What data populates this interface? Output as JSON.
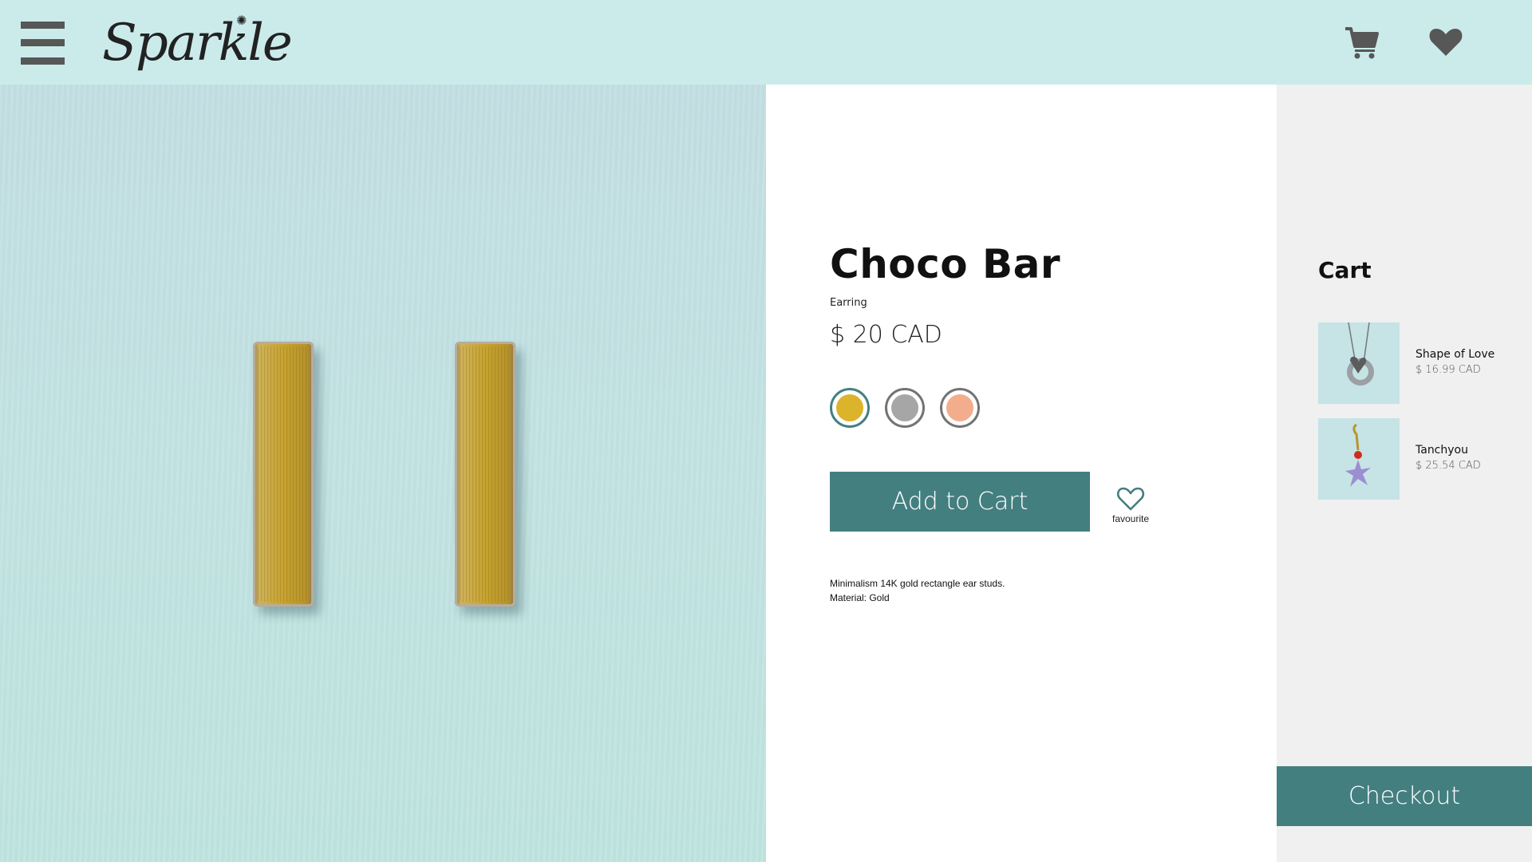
{
  "header": {
    "logo_text": "Sparkle",
    "logo_sparkle_glyph": "✺",
    "icons": [
      "menu-icon",
      "cart-icon",
      "heart-icon"
    ]
  },
  "product": {
    "title": "Choco Bar",
    "category": "Earring",
    "price": "$ 20 CAD",
    "swatches": [
      {
        "name": "gold",
        "color": "#dbb42c",
        "selected": true
      },
      {
        "name": "silver",
        "color": "#a6a6a6",
        "selected": false
      },
      {
        "name": "rose",
        "color": "#f2ae8c",
        "selected": false
      }
    ],
    "add_to_cart_label": "Add to Cart",
    "favourite_label": "favourite",
    "description_line1": "Minimalism 14K gold rectangle ear studs.",
    "description_line2": "Material: Gold"
  },
  "cart": {
    "title": "Cart",
    "items": [
      {
        "name": "Shape of Love",
        "price": "$ 16.99 CAD"
      },
      {
        "name": "Tanchyou",
        "price": "$ 25.54 CAD"
      }
    ],
    "checkout_label": "Checkout"
  },
  "colors": {
    "header_bg": "#cbebeb",
    "accent": "#447f80",
    "cart_bg": "#f0f0f0",
    "icon_gray": "#575757"
  }
}
